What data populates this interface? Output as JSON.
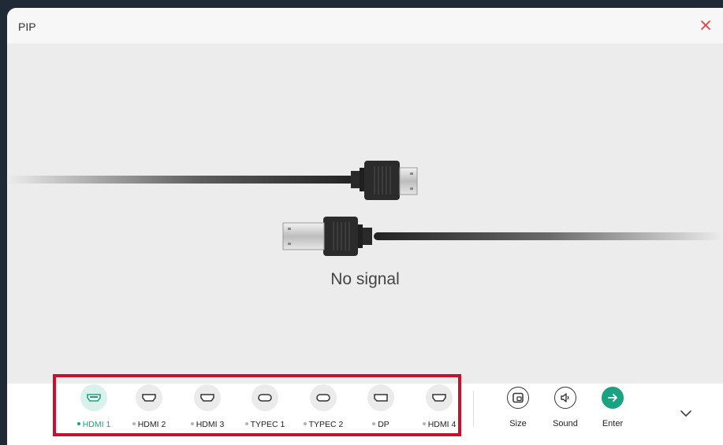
{
  "window": {
    "title": "PIP"
  },
  "preview": {
    "status": "No signal"
  },
  "sources": [
    {
      "label": "HDMI 1",
      "icon": "hdmi-icon",
      "active": true
    },
    {
      "label": "HDMI 2",
      "icon": "hdmi-icon",
      "active": false
    },
    {
      "label": "HDMI 3",
      "icon": "hdmi-icon",
      "active": false
    },
    {
      "label": "TYPEC 1",
      "icon": "usb-c-icon",
      "active": false
    },
    {
      "label": "TYPEC 2",
      "icon": "usb-c-icon",
      "active": false
    },
    {
      "label": "DP",
      "icon": "displayport-icon",
      "active": false
    },
    {
      "label": "HDMI 4",
      "icon": "hdmi-icon",
      "active": false
    }
  ],
  "actions": {
    "size": "Size",
    "sound": "Sound",
    "enter": "Enter"
  },
  "colors": {
    "accent": "#1aa283",
    "highlight_box": "#c8102e",
    "close": "#e53935"
  }
}
